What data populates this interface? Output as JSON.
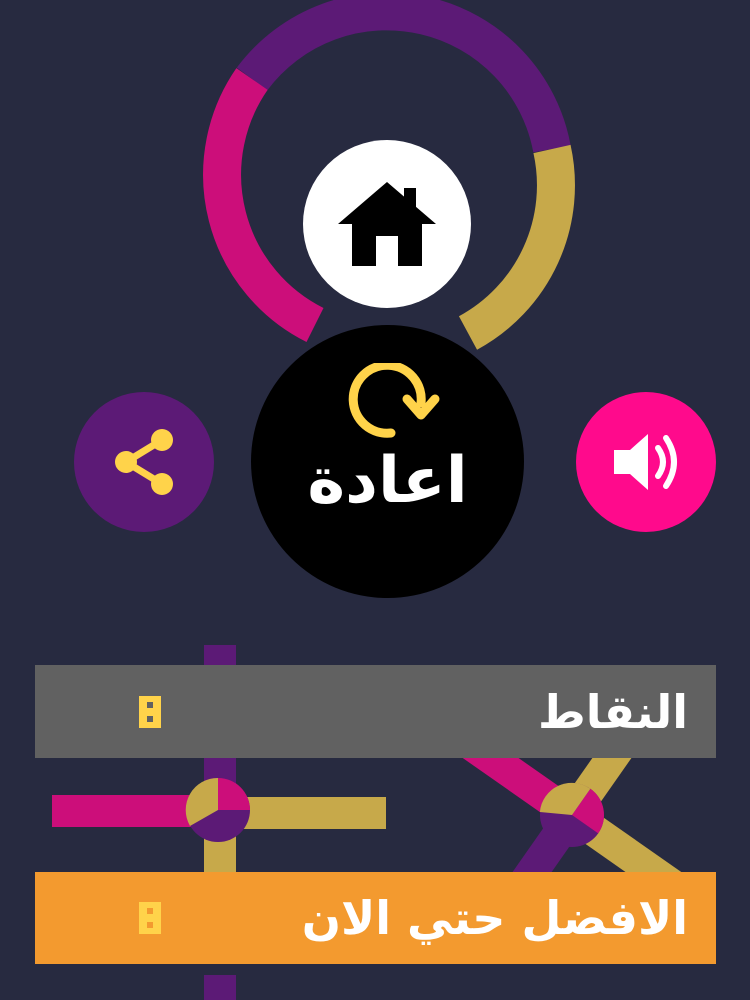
{
  "colors": {
    "background": "#272a40",
    "purple": "#5c1a76",
    "magenta": "#cc0e7a",
    "gold": "#c7a94a",
    "pink": "#ff0a8c",
    "yellow": "#ffd34a",
    "score_bar": "#616161",
    "best_bar": "#f39a2f"
  },
  "buttons": {
    "home_icon": "house-icon",
    "replay_label": "اعادة",
    "replay_icon": "circular-arrow-icon",
    "share_icon": "share-icon",
    "sound_icon": "speaker-volume-icon"
  },
  "score": {
    "label": "النقاط",
    "value": ""
  },
  "best": {
    "label": "الافضل حتي الان",
    "value": ""
  }
}
